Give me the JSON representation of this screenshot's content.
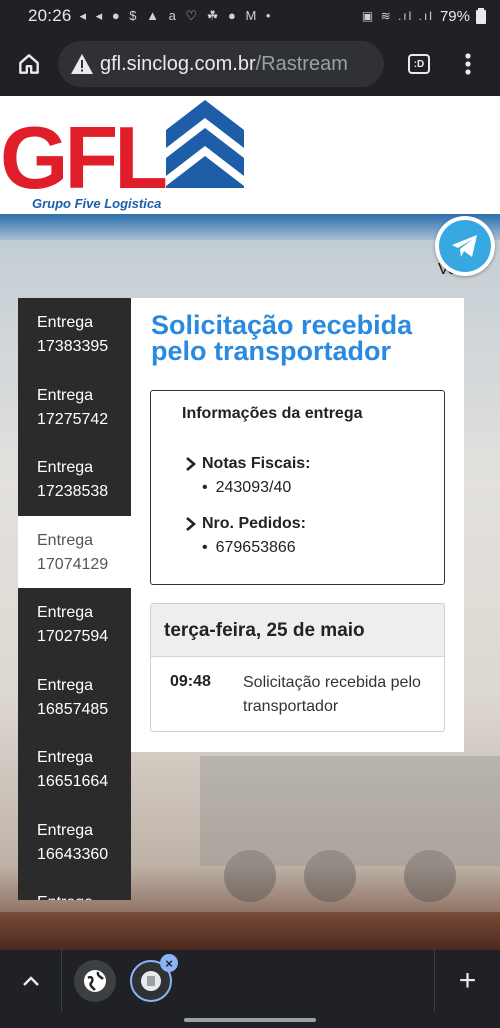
{
  "status_bar": {
    "time": "20:26",
    "notification_icons": "◂ ◂ ● $ ▲ a ♡ ☘ ● M •",
    "system_icons": "▣ ≋ .ıl .ıl",
    "battery": "79%"
  },
  "browser": {
    "url_host": "gfl.sinclog.com.br",
    "url_path": "/Rastream",
    "tabs_label": ":D"
  },
  "header": {
    "logo_text": "GFL",
    "logo_subtitle": "Grupo Five Logistica",
    "voltar_label": "Voltar"
  },
  "sidebar": {
    "items": [
      {
        "label": "Entrega",
        "number": "17383395"
      },
      {
        "label": "Entrega",
        "number": "17275742"
      },
      {
        "label": "Entrega",
        "number": "17238538"
      },
      {
        "label": "Entrega",
        "number": "17074129"
      },
      {
        "label": "Entrega",
        "number": "17027594"
      },
      {
        "label": "Entrega",
        "number": "16857485"
      },
      {
        "label": "Entrega",
        "number": "16651664"
      },
      {
        "label": "Entrega",
        "number": "16643360"
      },
      {
        "label": "Entrega",
        "number": ""
      }
    ],
    "active_index": 3
  },
  "content": {
    "status_title": "Solicitação recebida pelo transportador",
    "info_heading": "Informações da entrega",
    "notas_label": "Notas Fiscais:",
    "notas_value": "243093/40",
    "pedidos_label": "Nro. Pedidos:",
    "pedidos_value": "679653866",
    "timeline": {
      "date": "terça-feira, 25 de maio",
      "events": [
        {
          "time": "09:48",
          "description": "Solicitação recebida pelo transportador"
        }
      ]
    }
  },
  "colors": {
    "accent_blue": "#2a8ae0",
    "logo_red": "#e01e2a",
    "logo_blue": "#1e5ea8",
    "sidebar_dark": "#2b2b2b",
    "telegram": "#38a8e0"
  }
}
